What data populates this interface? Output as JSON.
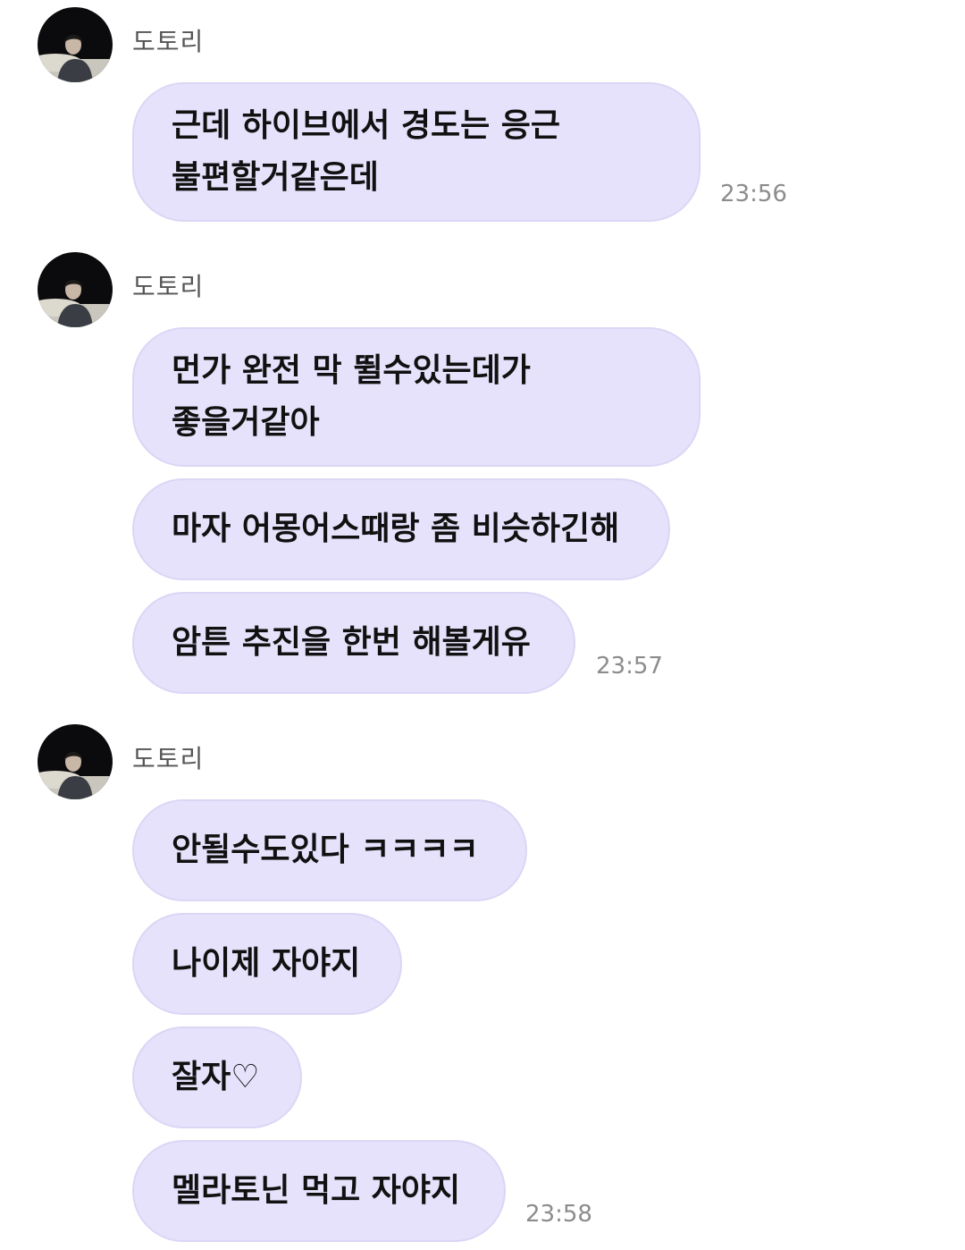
{
  "chat": {
    "groups": [
      {
        "sender": "도토리",
        "messages": [
          {
            "lines": [
              "근데 하이브에서 경도는 응근",
              "불편할거같은데"
            ],
            "time": "23:56"
          }
        ]
      },
      {
        "sender": "도토리",
        "messages": [
          {
            "lines": [
              "먼가 완전 막 뛸수있는데가",
              "좋을거같아"
            ]
          },
          {
            "lines": [
              "마자 어몽어스때랑 좀 비슷하긴해"
            ]
          },
          {
            "lines": [
              "암튼 추진을 한번 해볼게유"
            ],
            "time": "23:57"
          }
        ]
      },
      {
        "sender": "도토리",
        "messages": [
          {
            "lines": [
              "안될수도있다 ㅋㅋㅋㅋ"
            ]
          },
          {
            "lines": [
              "나이제 자야지"
            ]
          },
          {
            "lines": [
              "잘자♡"
            ]
          },
          {
            "lines": [
              "멜라토닌 먹고 자야지"
            ],
            "time": "23:58"
          }
        ]
      }
    ]
  },
  "colors": {
    "bubble_background": "#e6e2fb",
    "bubble_border": "#dbd6f5",
    "timestamp": "#8c8c8c",
    "sender_name": "#555555"
  },
  "icons": {
    "avatar": "profile-photo-icon"
  }
}
